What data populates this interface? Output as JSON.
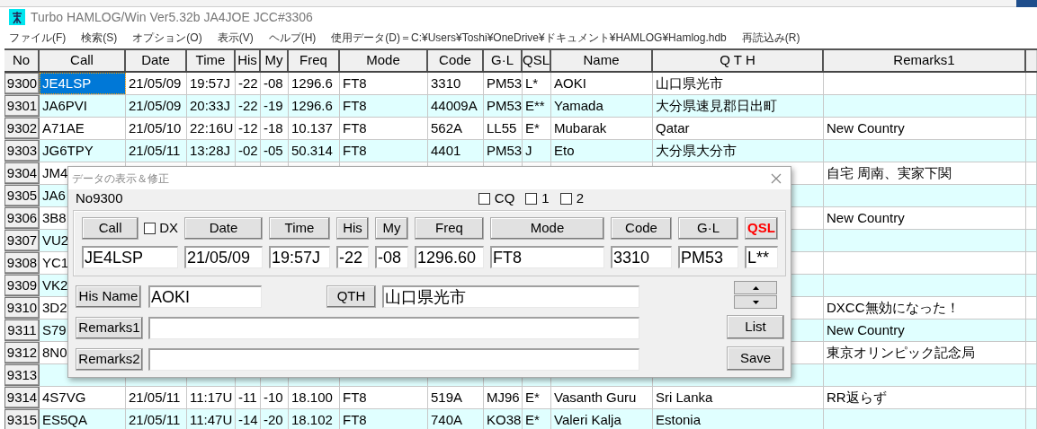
{
  "window": {
    "title": "Turbo HAMLOG/Win Ver5.32b JA4JOE JCC#3306"
  },
  "menu": [
    "ファイル(F)",
    "検索(S)",
    "オプション(O)",
    "表示(V)",
    "ヘルプ(H)",
    "使用データ(D)＝C:¥Users¥Toshi¥OneDrive¥ドキュメント¥HAMLOG¥Hamlog.hdb",
    "再読込み(R)"
  ],
  "table": {
    "columns": [
      "No",
      "Call",
      "Date",
      "Time",
      "His",
      "My",
      "Freq",
      "Mode",
      "Code",
      "G·L",
      "QSL",
      "Name",
      "Q T H",
      "Remarks1"
    ],
    "rows": [
      {
        "no": "9300",
        "call": "JE4LSP",
        "date": "21/05/09",
        "time": "19:57J",
        "his": "-22",
        "my": "-08",
        "freq": "1296.6",
        "mode": "FT8",
        "code": "3310",
        "gl": "PM53",
        "qsl": "L*",
        "name": "AOKI",
        "qth": "山口県光市",
        "selected": true
      },
      {
        "no": "9301",
        "call": "JA6PVI",
        "date": "21/05/09",
        "time": "20:33J",
        "his": "-22",
        "my": "-19",
        "freq": "1296.6",
        "mode": "FT8",
        "code": "44009A",
        "gl": "PM53",
        "qsl": "E**",
        "name": "Yamada",
        "qth": "大分県速見郡日出町",
        "selected": false
      },
      {
        "no": "9302",
        "call": "A71AE",
        "date": "21/05/10",
        "time": "22:16U",
        "his": "-12",
        "my": "-18",
        "freq": "10.137",
        "mode": "FT8",
        "code": "562A",
        "gl": "LL55",
        "qsl": "E*",
        "name": "Mubarak",
        "qth": "Qatar",
        "remarks1": "New Country",
        "selected": false
      },
      {
        "no": "9303",
        "call": "JG6TPY",
        "date": "21/05/11",
        "time": "13:28J",
        "his": "-02",
        "my": "-05",
        "freq": "50.314",
        "mode": "FT8",
        "code": "4401",
        "gl": "PM53",
        "qsl": "J",
        "name": "Eto",
        "qth": "大分県大分市",
        "selected": false
      },
      {
        "no": "9304",
        "call": "JM4",
        "remarks1": "自宅 周南、実家下関",
        "selected": false
      },
      {
        "no": "9305",
        "call": "JA6",
        "selected": false
      },
      {
        "no": "9306",
        "call": "3B8",
        "remarks1": "New Country",
        "selected": false
      },
      {
        "no": "9307",
        "call": "VU2",
        "selected": false
      },
      {
        "no": "9308",
        "call": "YC1",
        "selected": false
      },
      {
        "no": "9309",
        "call": "VK2",
        "selected": false
      },
      {
        "no": "9310",
        "call": "3D2",
        "remarks1": "DXCC無効になった！",
        "selected": false
      },
      {
        "no": "9311",
        "call": "S79",
        "remarks1": "New Country",
        "selected": false
      },
      {
        "no": "9312",
        "call": "8N0",
        "remarks1": "東京オリンピック記念局",
        "selected": false
      },
      {
        "no": "9313",
        "selected": false
      },
      {
        "no": "9314",
        "call": "4S7VG",
        "date": "21/05/11",
        "time": "11:17U",
        "his": "-11",
        "my": "-10",
        "freq": "18.100",
        "mode": "FT8",
        "code": "519A",
        "gl": "MJ96",
        "qsl": "E*",
        "name": "Vasanth Guru",
        "qth": "Sri Lanka",
        "remarks1": "RR返らず",
        "selected": false
      },
      {
        "no": "9315",
        "call": "ES5QA",
        "date": "21/05/11",
        "time": "11:47U",
        "his": "-14",
        "my": "-20",
        "freq": "18.102",
        "mode": "FT8",
        "code": "740A",
        "gl": "KO38",
        "qsl": "E*",
        "name": "Valeri Kalja",
        "qth": "Estonia",
        "selected": false
      }
    ]
  },
  "dialog": {
    "title": "データの表示＆修正",
    "record": "No9300",
    "flags": [
      {
        "label": "CQ",
        "checked": false
      },
      {
        "label": "1",
        "checked": false
      },
      {
        "label": "2",
        "checked": false
      }
    ],
    "dx": {
      "label": "DX",
      "checked": false
    },
    "fields": [
      {
        "label": "Call",
        "value": "JE4LSP",
        "color": "#000000"
      },
      {
        "label": "Date",
        "value": "21/05/09",
        "color": "#000000"
      },
      {
        "label": "Time",
        "value": "19:57J",
        "color": "#000000"
      },
      {
        "label": "His",
        "value": "-22",
        "color": "#000000"
      },
      {
        "label": "My",
        "value": "-08",
        "color": "#000000"
      },
      {
        "label": "Freq",
        "value": "1296.60",
        "color": "#000000"
      },
      {
        "label": "Mode",
        "value": "FT8",
        "color": "#000000"
      },
      {
        "label": "Code",
        "value": "3310",
        "color": "#000000"
      },
      {
        "label": "G·L",
        "value": "PM53",
        "color": "#000000"
      },
      {
        "label": "QSL",
        "value": "L**",
        "color": "#ff0000"
      }
    ],
    "name": {
      "label": "His Name",
      "value": "AOKI"
    },
    "qth": {
      "label": "QTH",
      "value": "山口県光市"
    },
    "remarks": [
      {
        "label": "Remarks1"
      },
      {
        "label": "Remarks2"
      }
    ],
    "actions": [
      {
        "label": "List"
      },
      {
        "label": "Save"
      }
    ]
  }
}
